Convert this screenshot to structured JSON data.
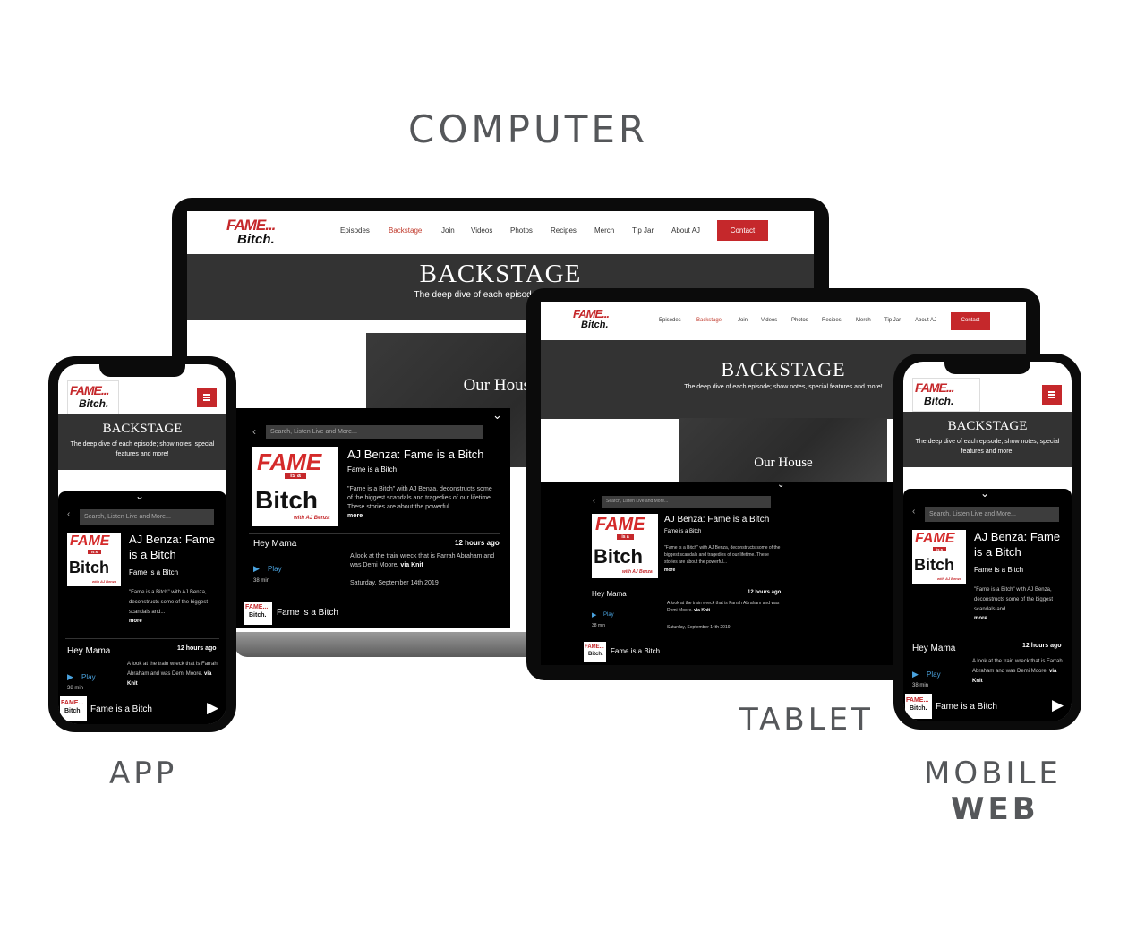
{
  "headings": {
    "computer": "COMPUTER",
    "tablet": "TABLET",
    "app": "APP",
    "mobile1": "MOBILE",
    "mobile2": "WEB"
  },
  "site": {
    "logo_top": "FAME...",
    "logo_bottom": "Bitch.",
    "nav": [
      "Episodes",
      "Backstage",
      "Join",
      "Videos",
      "Photos",
      "Recipes",
      "Merch",
      "Tip Jar",
      "About AJ"
    ],
    "contact": "Contact",
    "hero_title": "BACKSTAGE",
    "hero_sub_desktop": "The deep dive of each episode; show notes",
    "hero_sub_tablet": "The deep dive of each episode; show notes, special features and more!",
    "hero_sub_mobile": "The deep dive of each episode; show notes, special features and more!",
    "photo_title": "Our House"
  },
  "player": {
    "search": "Search, Listen Live and More...",
    "title": "AJ Benza: Fame is a Bitch",
    "artist": "Fame is a Bitch",
    "desc": "\"Fame is a Bitch\" with AJ Benza, deconstructs some of the biggest scandals and tragedies of our lifetime. These stories are about the powerful...",
    "desc_short": "\"Fame is a Bitch\" with AJ Benza, deconstructs some of the biggest scandals and...",
    "more": "more",
    "episode": "Hey Mama",
    "ago": "12 hours ago",
    "ep_desc": "A look at the train wreck that is Farrah Abraham and was Demi Moore.",
    "via": "via Knit",
    "play": "Play",
    "duration": "38 min",
    "date": "Saturday, September 14th 2019",
    "footer_title": "Fame is a Bitch",
    "cover_fame": "FAME",
    "cover_isa": "is a",
    "cover_bitch": "Bitch",
    "cover_with": "with AJ Benza"
  },
  "colors": {
    "accent": "#c5282b",
    "hero": "#333333",
    "player": "#000000",
    "play": "#4aa3df"
  },
  "icons": [
    "chevron-left-icon",
    "chevron-down-icon",
    "play-icon",
    "menu-icon"
  ]
}
